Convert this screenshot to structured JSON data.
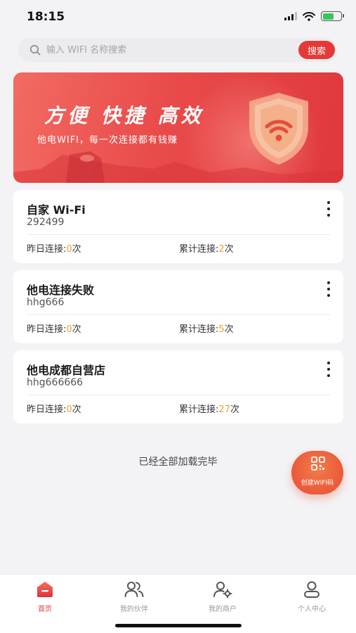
{
  "status_bar": {
    "time": "18:15"
  },
  "search": {
    "placeholder": "输入 WIFI 名称搜索",
    "button_label": "搜索"
  },
  "banner": {
    "title": "方便 快捷 高效",
    "subtitle": "他电WIFI，每一次连接都有钱赚"
  },
  "wifi_list": [
    {
      "name": "自家 Wi-Fi",
      "password": "292499",
      "yesterday_label": "昨日连接:",
      "yesterday_count": "0",
      "total_label": "累计连接:",
      "total_count": "2",
      "unit": "次"
    },
    {
      "name": "他电连接失败",
      "password": "hhg666",
      "yesterday_label": "昨日连接:",
      "yesterday_count": "0",
      "total_label": "累计连接:",
      "total_count": "5",
      "unit": "次"
    },
    {
      "name": "他电成都自营店",
      "password": "hhg666666",
      "yesterday_label": "昨日连接:",
      "yesterday_count": "0",
      "total_label": "累计连接:",
      "total_count": "27",
      "unit": "次"
    }
  ],
  "list_end_text": "已经全部加载完毕",
  "fab": {
    "label": "创建WIFI码",
    "icon": "qr-code-icon"
  },
  "tabs": [
    {
      "label": "首页",
      "icon": "home-icon",
      "active": true
    },
    {
      "label": "我的伙伴",
      "icon": "partners-icon",
      "active": false
    },
    {
      "label": "我的商户",
      "icon": "merchant-icon",
      "active": false
    },
    {
      "label": "个人中心",
      "icon": "profile-icon",
      "active": false
    }
  ],
  "colors": {
    "accent": "#e53935",
    "count_highlight": "#f0a030",
    "fab": "#ea5a3a"
  }
}
